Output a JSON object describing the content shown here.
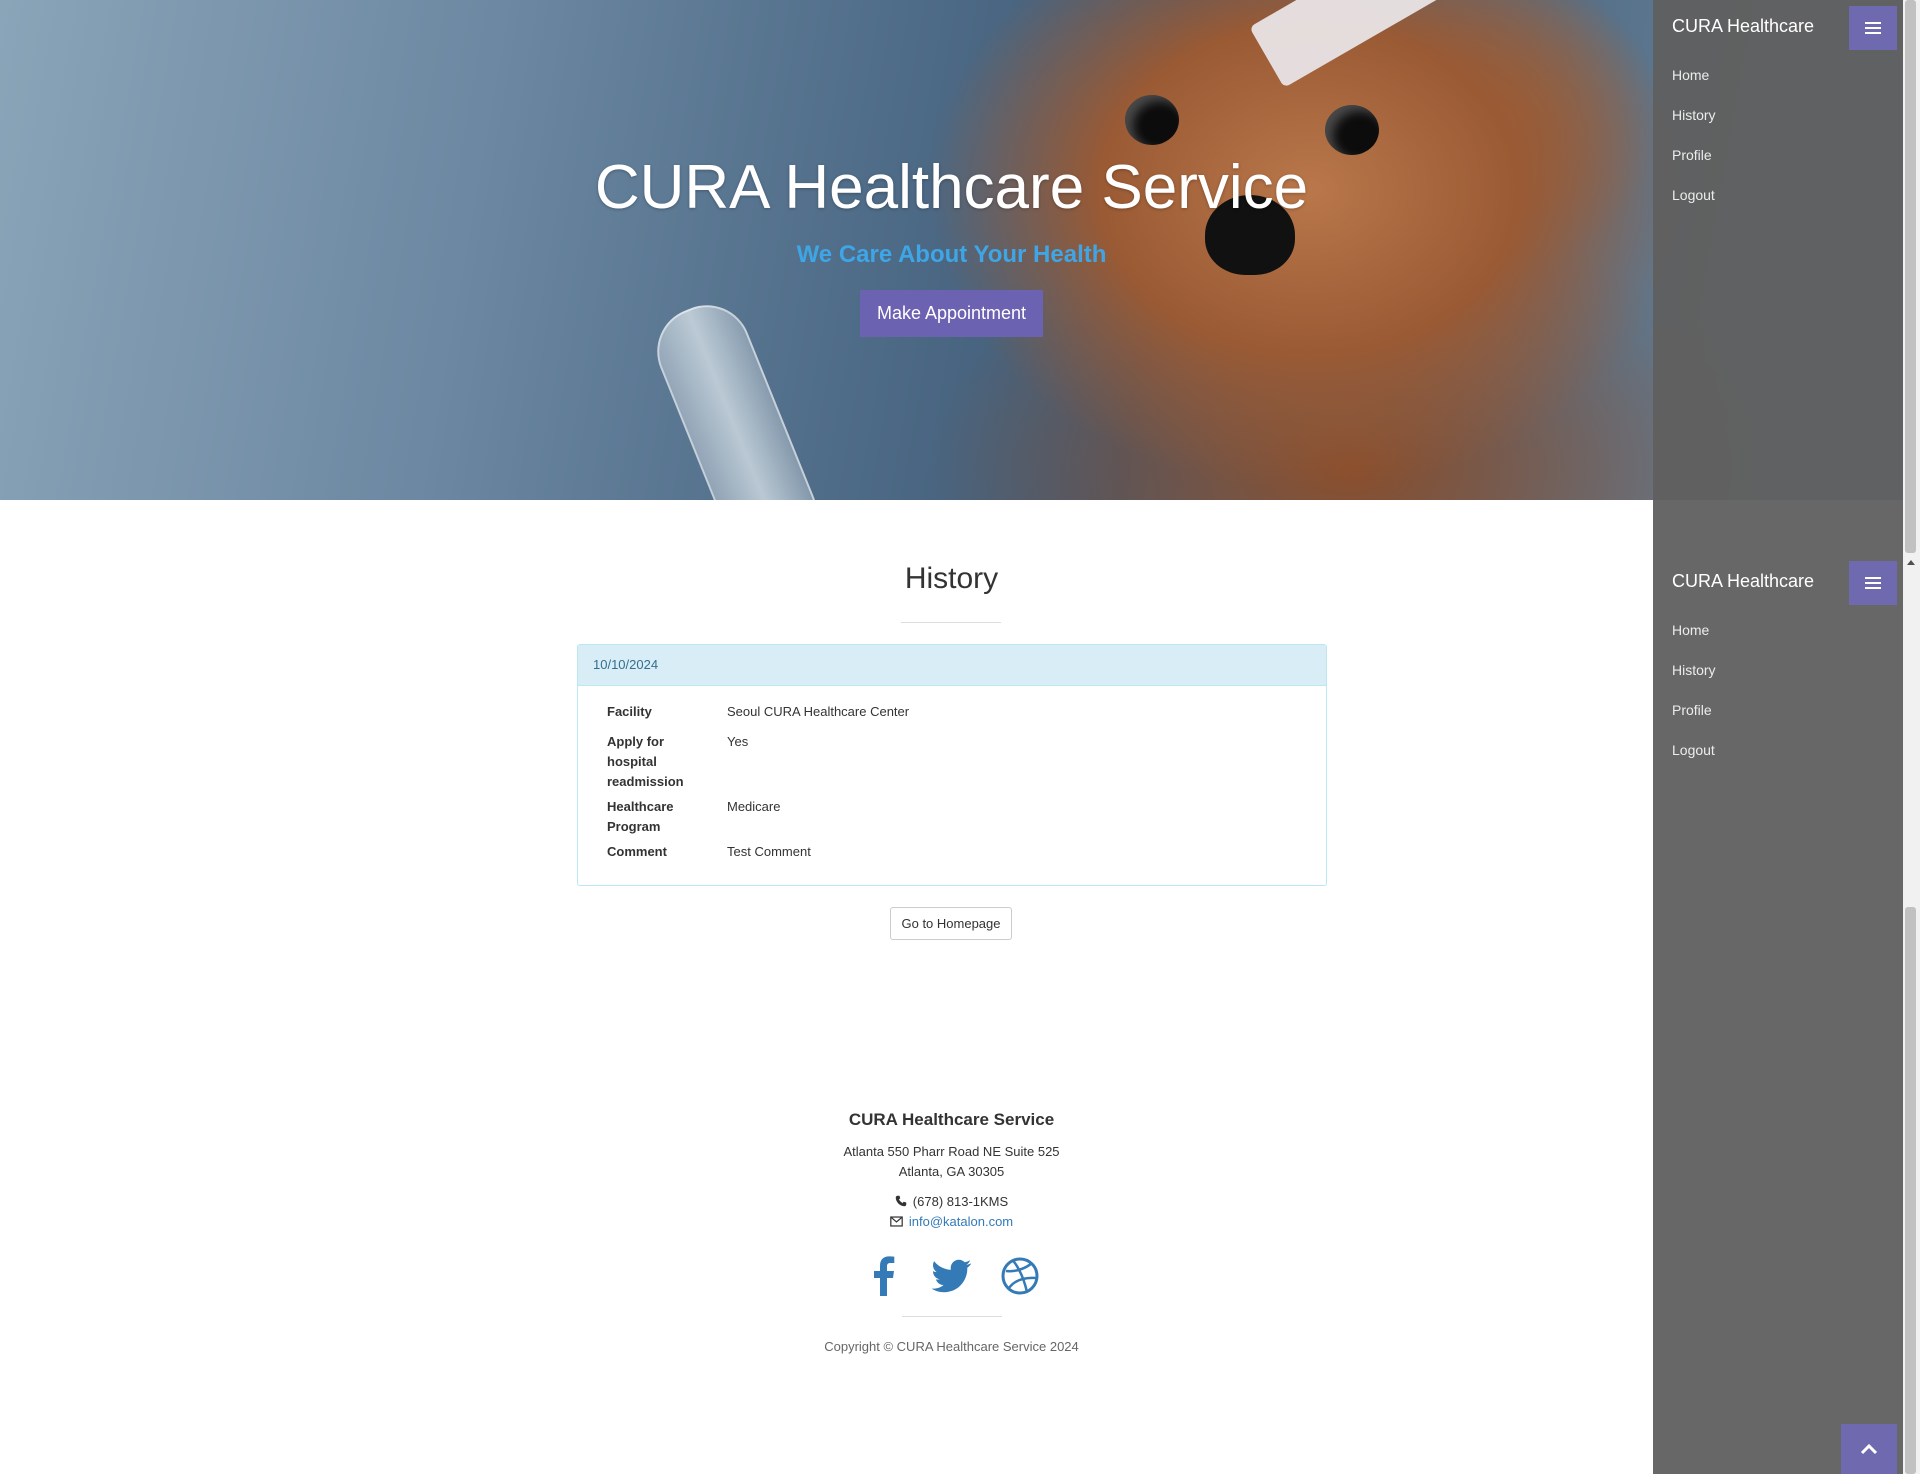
{
  "hero": {
    "title": "CURA Healthcare Service",
    "subtitle": "We Care About Your Health",
    "cta_label": "Make Appointment"
  },
  "sidebar": {
    "brand": "CURA Healthcare",
    "toggle_icon": "bars-icon",
    "items": [
      {
        "label": "Home"
      },
      {
        "label": "History"
      },
      {
        "label": "Profile"
      },
      {
        "label": "Logout"
      }
    ]
  },
  "history": {
    "title": "History",
    "appointment": {
      "date": "10/10/2024",
      "fields": [
        {
          "label": "Facility",
          "value": "Seoul CURA Healthcare Center"
        },
        {
          "label": "Apply for hospital readmission",
          "value": "Yes"
        },
        {
          "label": "Healthcare Program",
          "value": "Medicare"
        },
        {
          "label": "Comment",
          "value": "Test Comment"
        }
      ]
    },
    "home_button": "Go to Homepage"
  },
  "footer": {
    "title": "CURA Healthcare Service",
    "address_line1": "Atlanta 550 Pharr Road NE Suite 525",
    "address_line2": "Atlanta, GA 30305",
    "phone": "(678) 813-1KMS",
    "email": "info@katalon.com",
    "social": [
      "facebook-icon",
      "twitter-icon",
      "dribbble-icon"
    ],
    "copyright": "Copyright © CURA Healthcare Service 2024"
  },
  "colors": {
    "accent": "#6b62b1",
    "subtitle": "#3ea6e6",
    "link": "#337ab7",
    "panel_heading": "#d9edf7",
    "sidebar": "#5a5a5a"
  }
}
